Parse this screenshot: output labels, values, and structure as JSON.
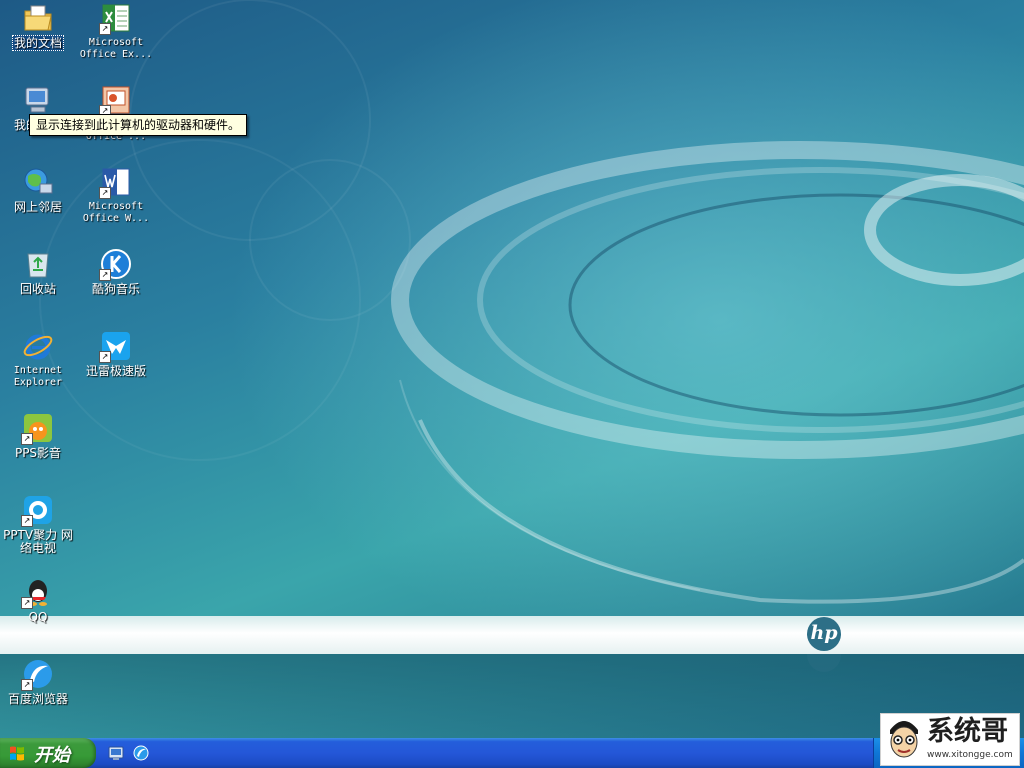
{
  "desktop": {
    "icons": [
      {
        "label": "我的文档",
        "icon": "my-documents-icon"
      },
      {
        "label": "我的电脑",
        "icon": "my-computer-icon"
      },
      {
        "label": "网上邻居",
        "icon": "network-places-icon"
      },
      {
        "label": "回收站",
        "icon": "recycle-bin-icon"
      },
      {
        "label": "Internet Explorer",
        "icon": "internet-explorer-icon"
      },
      {
        "label": "PPS影音",
        "icon": "pps-player-icon"
      },
      {
        "label": "PPTV聚力 网络电视",
        "icon": "pptv-icon"
      },
      {
        "label": "QQ",
        "icon": "qq-icon"
      },
      {
        "label": "百度浏览器",
        "icon": "baidu-browser-icon"
      },
      {
        "label": "Microsoft Office Ex...",
        "icon": "excel-icon"
      },
      {
        "label": "Microsoft Office ...",
        "icon": "powerpoint-icon"
      },
      {
        "label": "Microsoft Office W...",
        "icon": "word-icon"
      },
      {
        "label": "酷狗音乐",
        "icon": "kugou-music-icon"
      },
      {
        "label": "迅雷极速版",
        "icon": "xunlei-icon"
      }
    ],
    "tooltip": "显示连接到此计算机的驱动器和硬件。",
    "wallpaper_brand": "hp"
  },
  "taskbar": {
    "start_label": "开始",
    "quicklaunch": [
      {
        "icon": "show-desktop-icon"
      },
      {
        "icon": "browser-quicklaunch-icon"
      }
    ]
  },
  "watermark": {
    "title": "系统哥",
    "url": "www.xitongge.com"
  },
  "colors": {
    "taskbar": "#245edb",
    "start_button": "#3c9a3c",
    "tray": "#0f76d6",
    "tooltip_bg": "#ffffe1"
  }
}
